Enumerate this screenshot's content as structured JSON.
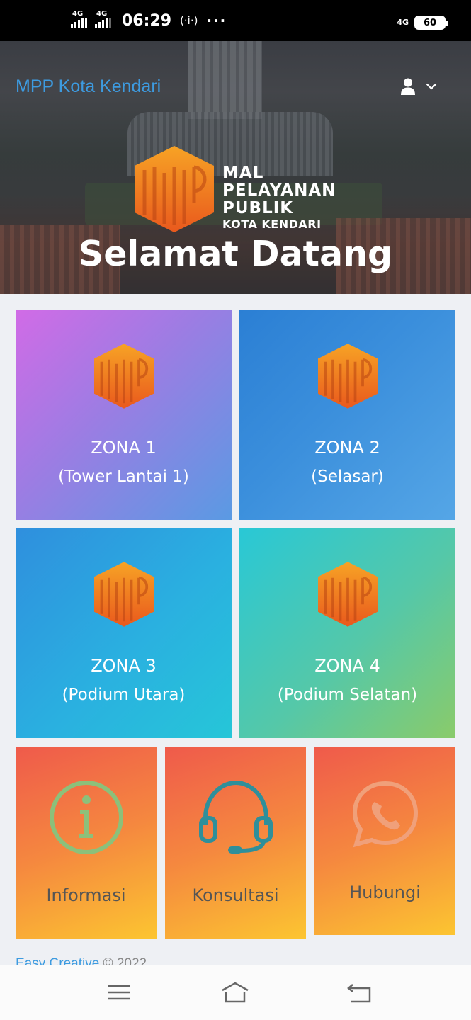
{
  "status_bar": {
    "sim1": "4G",
    "sim2": "4G",
    "time": "06:29",
    "hotspot": "(·i·)",
    "more": "···",
    "network_right": "4G",
    "battery": "60"
  },
  "header": {
    "brand": "MPP Kota Kendari",
    "user_icon": "user-icon",
    "dropdown_icon": "chevron-down-icon"
  },
  "hero": {
    "logo_line1": "MAL",
    "logo_line2": "PELAYANAN",
    "logo_line3": "PUBLIK",
    "logo_line4": "KOTA KENDARI",
    "welcome": "Selamat Datang",
    "logo_color_top": "#f5a623",
    "logo_color_bottom": "#e8571e"
  },
  "zones": [
    {
      "title": "ZONA 1",
      "subtitle": "(Tower Lantai 1)"
    },
    {
      "title": "ZONA 2",
      "subtitle": "(Selasar)"
    },
    {
      "title": "ZONA 3",
      "subtitle": "(Podium Utara)"
    },
    {
      "title": "ZONA 4",
      "subtitle": "(Podium Selatan)"
    }
  ],
  "actions": [
    {
      "label": "Informasi",
      "icon": "info-icon",
      "color": "#8cc07a"
    },
    {
      "label": "Konsultasi",
      "icon": "headset-icon",
      "color": "#2f8f9a"
    },
    {
      "label": "Hubungi",
      "icon": "whatsapp-icon",
      "color": "#f0a07a"
    }
  ],
  "footer": {
    "link": "Easy Creative",
    "text": " © 2022"
  },
  "nav": {
    "menu_icon": "menu-icon",
    "home_icon": "home-icon",
    "back_icon": "back-icon"
  }
}
